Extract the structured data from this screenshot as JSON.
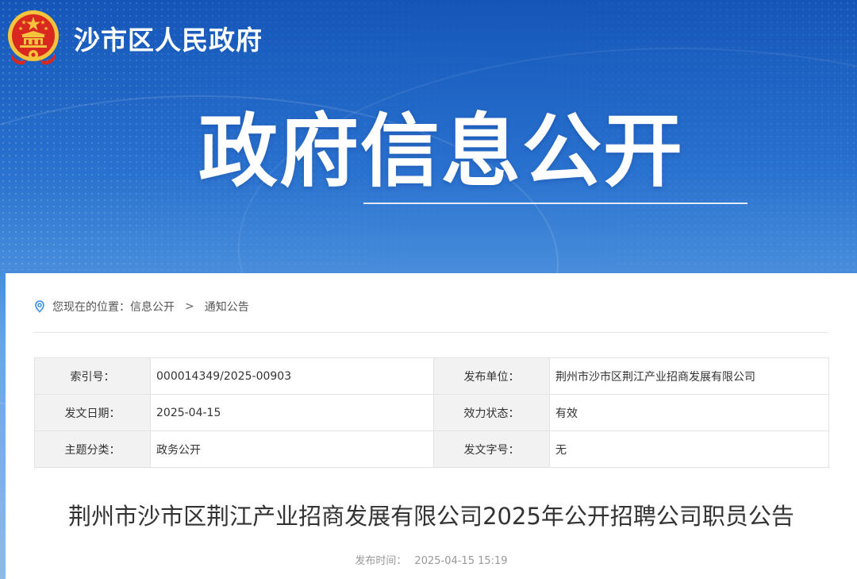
{
  "header": {
    "site_name": "沙市区人民政府",
    "hero_title": "政府信息公开"
  },
  "breadcrumb": {
    "prefix": "您现在的位置：",
    "items": [
      "信息公开",
      "通知公告"
    ],
    "separator": ">"
  },
  "meta_table": {
    "rows": [
      {
        "label_left": "索引号：",
        "value_left": "000014349/2025-00903",
        "label_right": "发布单位：",
        "value_right": "荆州市沙市区荆江产业招商发展有限公司"
      },
      {
        "label_left": "发文日期：",
        "value_left": "2025-04-15",
        "label_right": "效力状态：",
        "value_right": "有效"
      },
      {
        "label_left": "主题分类：",
        "value_left": "政务公开",
        "label_right": "发文字号：",
        "value_right": "无"
      }
    ]
  },
  "article": {
    "title": "荆州市沙市区荆江产业招商发展有限公司2025年公开招聘公司职员公告",
    "publish_label": "发布时间：",
    "publish_time": "2025-04-15 15:19"
  },
  "colors": {
    "banner_top": "#1456b8",
    "banner_bottom": "#8cbbe9",
    "emblem_red": "#d8281f",
    "emblem_gold": "#f6c43c",
    "location_icon": "#3a8ee6"
  }
}
